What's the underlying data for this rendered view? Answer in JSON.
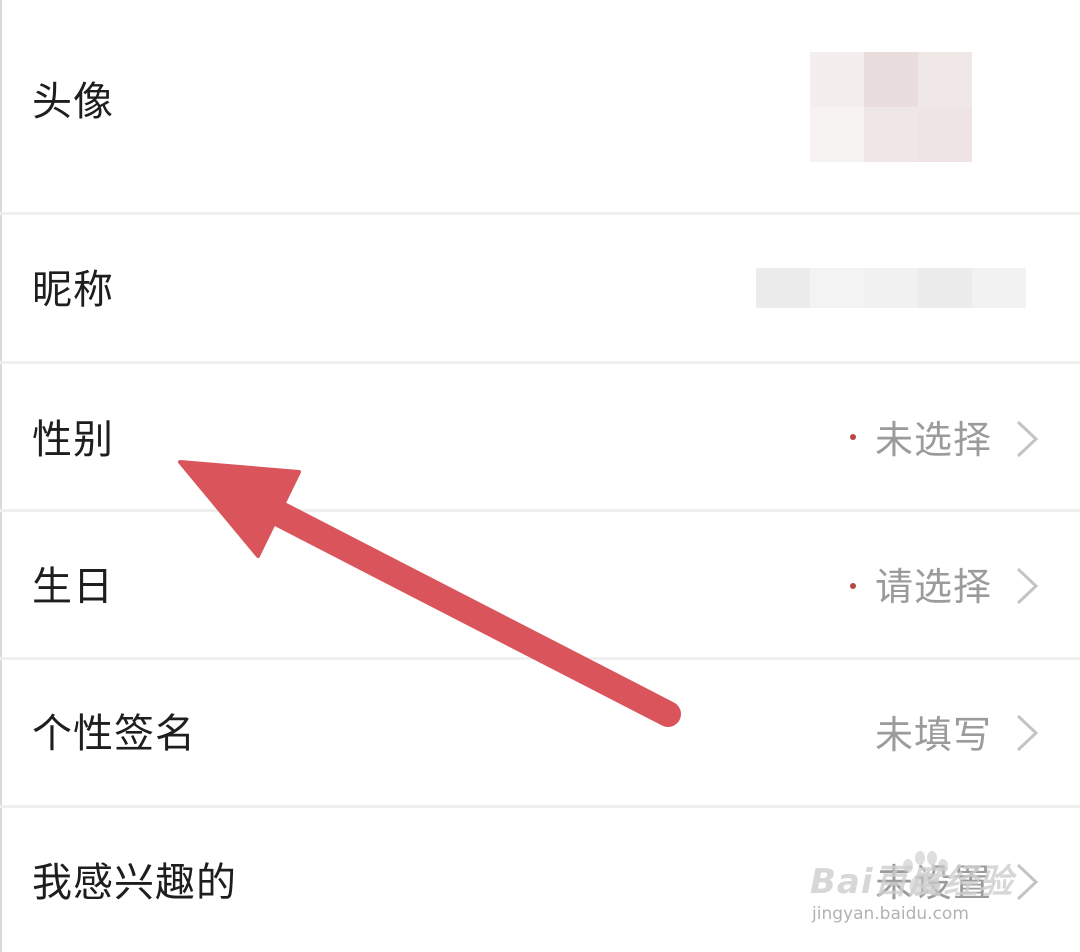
{
  "profile": {
    "rows": [
      {
        "label": "头像",
        "value": "",
        "required": false
      },
      {
        "label": "昵称",
        "value": "",
        "required": false
      },
      {
        "label": "性别",
        "value": "未选择",
        "required": true
      },
      {
        "label": "生日",
        "value": "请选择",
        "required": true
      },
      {
        "label": "个性签名",
        "value": "未填写",
        "required": false
      },
      {
        "label": "我感兴趣的",
        "value": "未设置",
        "required": false
      }
    ]
  },
  "annotation": {
    "arrow_color": "#d9555b"
  },
  "watermark": {
    "main": "Bai百度经验",
    "sub": "jingyan.baidu.com"
  },
  "icons": {
    "row_chevron": "chevron-right-icon"
  }
}
